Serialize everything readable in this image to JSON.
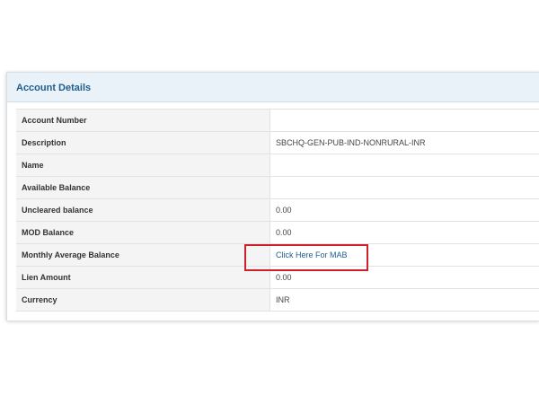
{
  "panel": {
    "title": "Account Details"
  },
  "rows": [
    {
      "label": "Account Number",
      "value": ""
    },
    {
      "label": "Description",
      "value": "SBCHQ-GEN-PUB-IND-NONRURAL-INR"
    },
    {
      "label": "Name",
      "value": ""
    },
    {
      "label": "Available Balance",
      "value": ""
    },
    {
      "label": "Uncleared balance",
      "value": "0.00"
    },
    {
      "label": "MOD Balance",
      "value": "0.00"
    },
    {
      "label": "Monthly Average Balance",
      "value": "Click Here For MAB"
    },
    {
      "label": "Lien Amount",
      "value": "0.00"
    },
    {
      "label": "Currency",
      "value": "INR"
    }
  ],
  "colors": {
    "header_bg": "#e9f2f8",
    "title_color": "#1f5d8d",
    "highlight": "#cf1f2b"
  }
}
